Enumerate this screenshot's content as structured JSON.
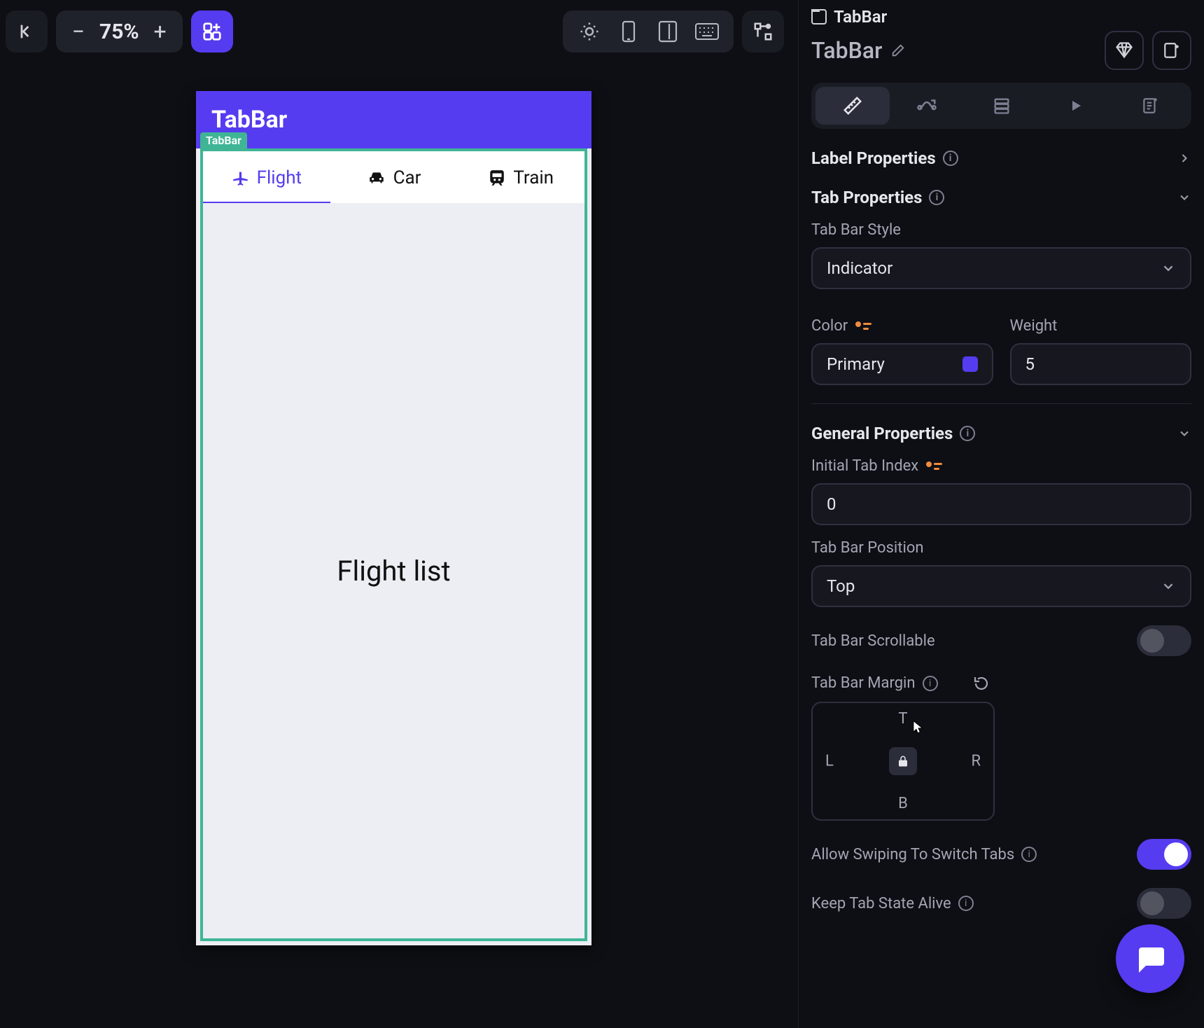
{
  "toolbar": {
    "zoom": "75%"
  },
  "preview": {
    "appbar_title": "TabBar",
    "selection_tag": "TabBar",
    "tabs": [
      {
        "label": "Flight",
        "icon": "airplane",
        "active": true
      },
      {
        "label": "Car",
        "icon": "car",
        "active": false
      },
      {
        "label": "Train",
        "icon": "train",
        "active": false
      }
    ],
    "body_text": "Flight list"
  },
  "panel": {
    "breadcrumb": "TabBar",
    "widget_name": "TabBar",
    "sections": {
      "label_properties": "Label Properties",
      "tab_properties": "Tab Properties",
      "general_properties": "General Properties"
    },
    "tab_bar_style": {
      "label": "Tab Bar Style",
      "value": "Indicator"
    },
    "color": {
      "label": "Color",
      "value": "Primary",
      "swatch": "#553cf0"
    },
    "weight": {
      "label": "Weight",
      "value": "5"
    },
    "initial_index": {
      "label": "Initial Tab Index",
      "value": "0"
    },
    "position": {
      "label": "Tab Bar Position",
      "value": "Top"
    },
    "scrollable": {
      "label": "Tab Bar Scrollable",
      "value": false
    },
    "margin": {
      "label": "Tab Bar Margin",
      "T": "T",
      "L": "L",
      "R": "R",
      "B": "B"
    },
    "allow_swipe": {
      "label": "Allow Swiping To Switch Tabs",
      "value": true
    },
    "keep_alive": {
      "label": "Keep Tab State Alive",
      "value": false
    }
  }
}
